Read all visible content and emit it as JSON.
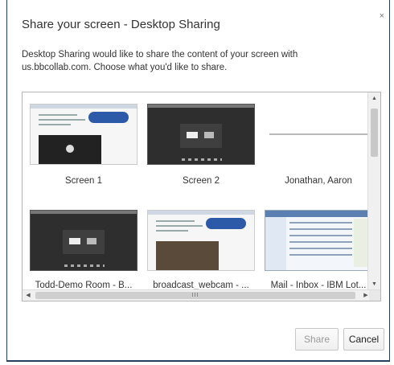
{
  "dialog": {
    "title": "Share your screen - Desktop Sharing",
    "close_glyph": "×",
    "description": "Desktop Sharing would like to share the content of your screen with us.bbcollab.com. Choose what you'd like to share."
  },
  "sources": [
    {
      "label": "Screen 1",
      "kind": "screen"
    },
    {
      "label": "Screen 2",
      "kind": "screen"
    },
    {
      "label": "Jonathan, Aaron",
      "kind": "window"
    },
    {
      "label": "Todd-Demo Room - B...",
      "kind": "window"
    },
    {
      "label": "broadcast_webcam - ...",
      "kind": "window"
    },
    {
      "label": "Mail - Inbox - IBM Lot...",
      "kind": "window"
    }
  ],
  "scrollbar": {
    "up_glyph": "▲",
    "down_glyph": "▼",
    "left_glyph": "◀",
    "right_glyph": "▶",
    "grip_glyph": "III"
  },
  "buttons": {
    "share_label": "Share",
    "cancel_label": "Cancel"
  },
  "colors": {
    "dialog_border": "#24405e",
    "share_disabled_text": "#9a9a9a"
  }
}
